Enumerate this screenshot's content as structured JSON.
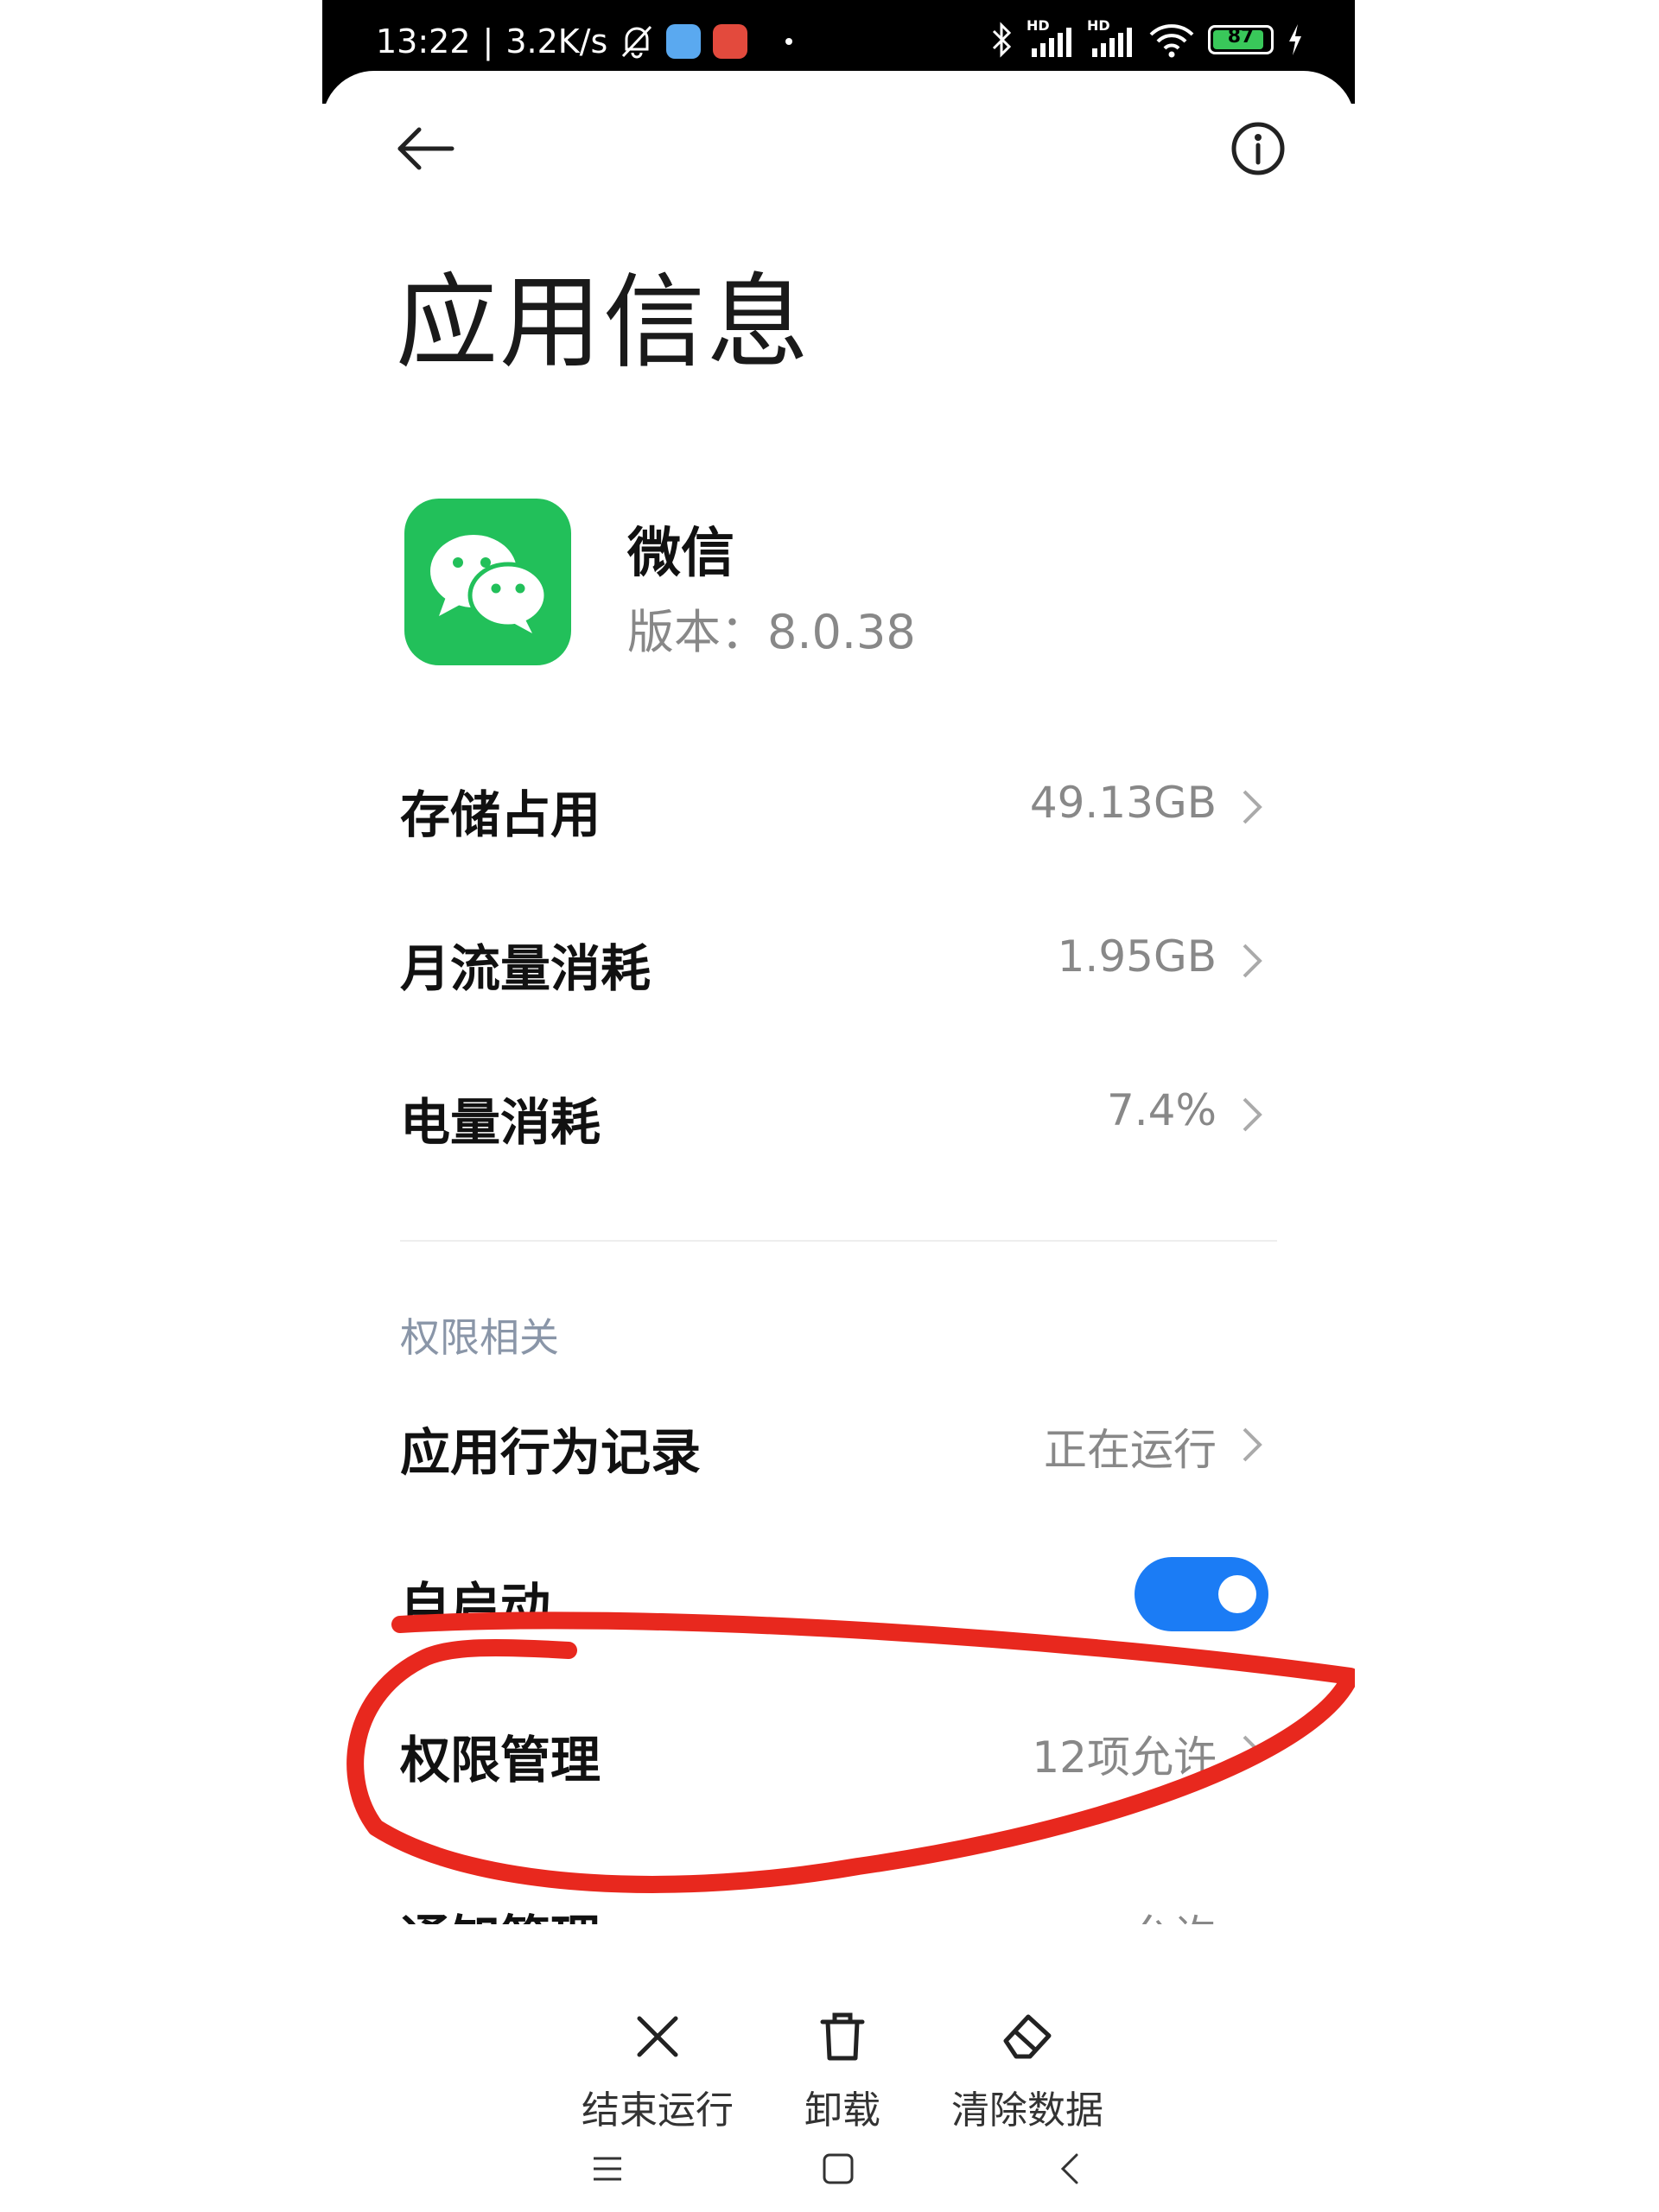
{
  "status_bar": {
    "time": "13:22",
    "speed": "3.2K/s",
    "separator": "|",
    "battery": "87",
    "hd1": "HD",
    "hd2": "HD"
  },
  "page": {
    "title": "应用信息"
  },
  "app": {
    "name": "微信",
    "version": "版本：8.0.38",
    "icon_color": "#22c05a"
  },
  "rows": {
    "storage": {
      "label": "存储占用",
      "value": "49.13GB"
    },
    "data": {
      "label": "月流量消耗",
      "value": "1.95GB"
    },
    "battery": {
      "label": "电量消耗",
      "value": "7.4%"
    }
  },
  "permissions_section": {
    "label": "权限相关",
    "behavior": {
      "label": "应用行为记录",
      "value": "正在运行"
    },
    "autostart": {
      "label": "自启动",
      "enabled": true
    },
    "permission_mgmt": {
      "label": "权限管理",
      "value": "12项允许"
    },
    "notification_partial": {
      "label": "通知管理",
      "value": "允许"
    }
  },
  "actions": {
    "stop": "结束运行",
    "uninstall": "卸载",
    "clear": "清除数据"
  },
  "colors": {
    "accent": "#1b7cf5",
    "annotation": "#e8281e",
    "section": "#8a96a8"
  }
}
